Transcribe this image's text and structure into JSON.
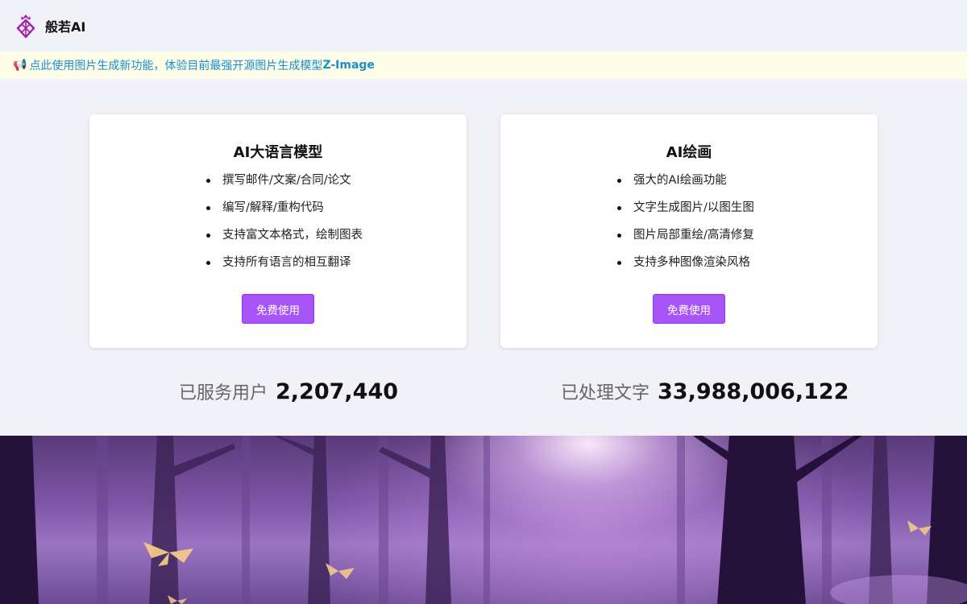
{
  "header": {
    "brand": "般若AI",
    "logo_icon": "pineapple-logo-icon"
  },
  "banner": {
    "icon": "megaphone-icon",
    "text": "点此使用图片生成新功能，体验目前最强开源图片生成模型",
    "link_text": "Z-Image"
  },
  "cards": [
    {
      "title": "AI大语言模型",
      "features": [
        "撰写邮件/文案/合同/论文",
        "编写/解释/重构代码",
        "支持富文本格式，绘制图表",
        "支持所有语言的相互翻译"
      ],
      "button": "免费使用"
    },
    {
      "title": "AI绘画",
      "features": [
        "强大的AI绘画功能",
        "文字生成图片/以图生图",
        "图片局部重绘/高清修复",
        "支持多种图像渲染风格"
      ],
      "button": "免费使用"
    }
  ],
  "stats": {
    "users_label": "已服务用户",
    "users_value": "2,207,440",
    "words_label": "已处理文字",
    "words_value": "33,988,006,122"
  },
  "colors": {
    "accent": "#a855f7",
    "banner_bg": "#fdfde8",
    "banner_text": "#1a8fd0",
    "page_bg": "#f0f2f7"
  }
}
